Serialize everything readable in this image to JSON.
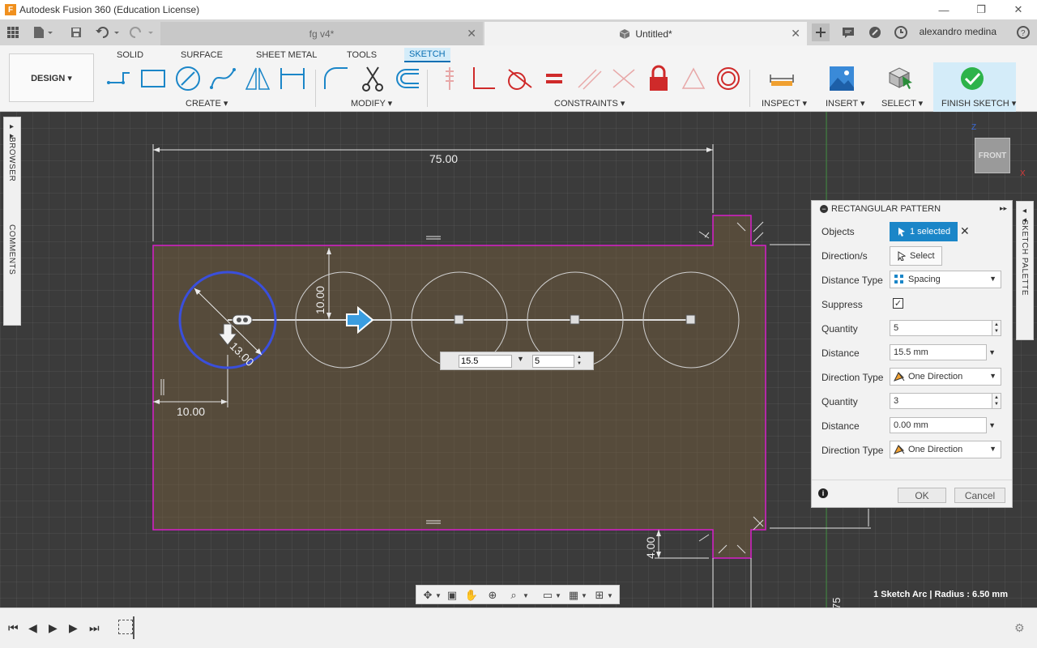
{
  "window": {
    "title": "Autodesk Fusion 360 (Education License)",
    "minimize": "—",
    "maximize": "❐",
    "close": "✕"
  },
  "tabs": [
    {
      "label": "fg v4*",
      "active": false
    },
    {
      "label": "Untitled*",
      "active": true
    }
  ],
  "user": {
    "name": "alexandro medina"
  },
  "toolbar": {
    "design_label": "DESIGN ▾",
    "workspace_tabs": [
      "SOLID",
      "SURFACE",
      "SHEET METAL",
      "TOOLS",
      "SKETCH"
    ],
    "active_workspace": "SKETCH",
    "groups": {
      "create": "CREATE ▾",
      "modify": "MODIFY ▾",
      "constraints": "CONSTRAINTS ▾",
      "inspect": "INSPECT ▾",
      "insert": "INSERT ▾",
      "select": "SELECT ▾",
      "finish": "FINISH SKETCH ▾"
    }
  },
  "side_panels": {
    "browser": "BROWSER",
    "comments": "COMMENTS",
    "sketch_palette": "SKETCH PALETTE"
  },
  "viewcube": {
    "label": "FRONT",
    "axis_z": "Z",
    "axis_x": "X"
  },
  "dimensions": {
    "width": "75.00",
    "offset_x": "10.00",
    "offset_y": "10.00",
    "radius": "13.00",
    "tab_height": "4.00",
    "edge_partial": "75"
  },
  "inline_input": {
    "distance": "15.5",
    "quantity": "5"
  },
  "dialog": {
    "title": "RECTANGULAR PATTERN",
    "rows": {
      "objects": {
        "label": "Objects",
        "value": "1 selected"
      },
      "directions": {
        "label": "Direction/s",
        "value": "Select"
      },
      "distance_type": {
        "label": "Distance Type",
        "value": "Spacing"
      },
      "suppress": {
        "label": "Suppress",
        "checked": true
      },
      "quantity1": {
        "label": "Quantity",
        "value": "5"
      },
      "distance1": {
        "label": "Distance",
        "value": "15.5 mm"
      },
      "direction_type1": {
        "label": "Direction Type",
        "value": "One Direction"
      },
      "quantity2": {
        "label": "Quantity",
        "value": "3"
      },
      "distance2": {
        "label": "Distance",
        "value": "0.00 mm"
      },
      "direction_type2": {
        "label": "Direction Type",
        "value": "One Direction"
      }
    },
    "ok": "OK",
    "cancel": "Cancel"
  },
  "status": {
    "text": "1 Sketch Arc | Radius : 6.50 mm"
  },
  "colors": {
    "accent": "#1b86c8",
    "sketch_profile": "#d81ec9",
    "selected_circle": "#3a4fdc",
    "finish_check": "#2db34a",
    "canvas_bg": "#3b3b3b"
  }
}
